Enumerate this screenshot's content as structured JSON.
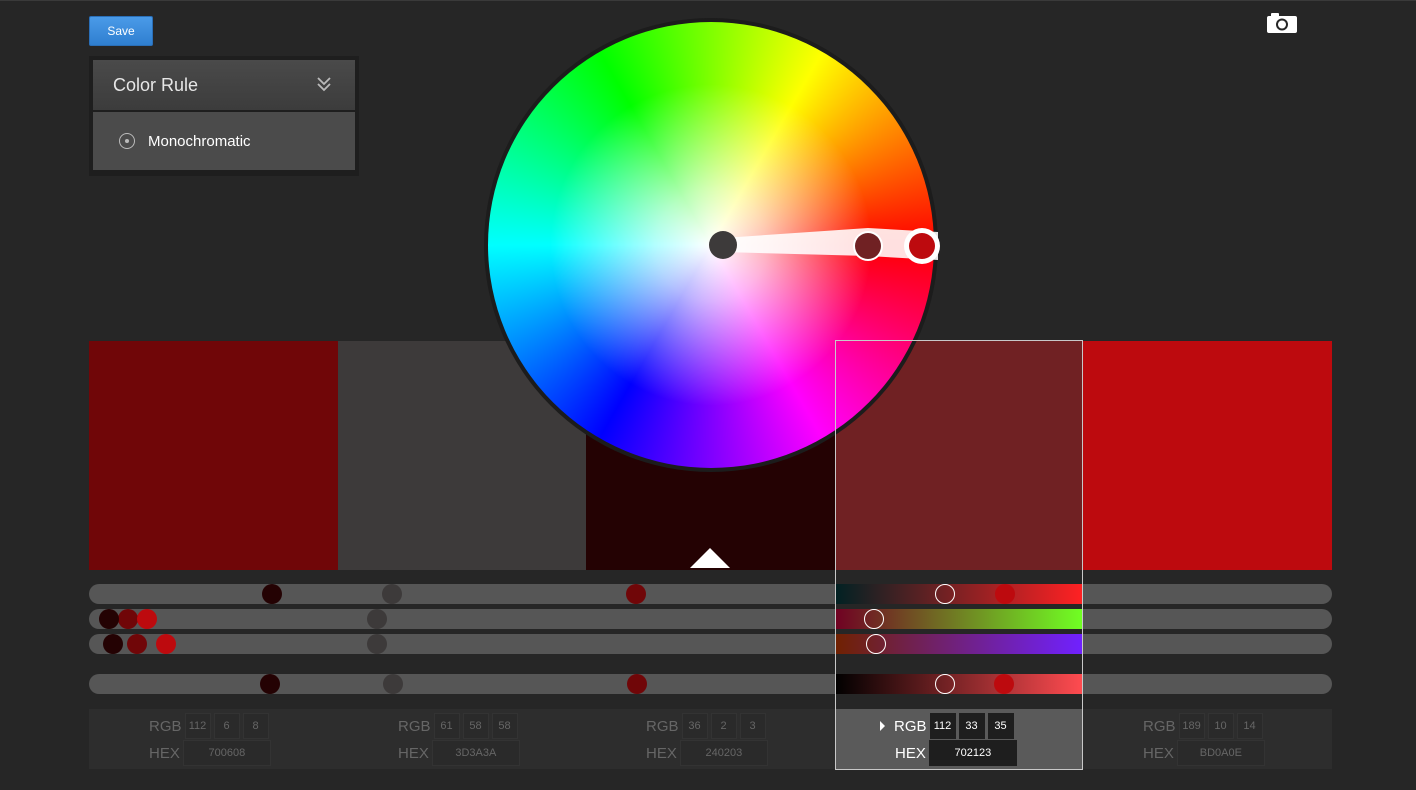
{
  "toolbar": {
    "save_label": "Save",
    "camera_icon": "camera-icon"
  },
  "color_rule": {
    "title": "Color Rule",
    "selected": "Monochromatic"
  },
  "swatches": [
    {
      "hex": "700608",
      "r": "112",
      "g": "6",
      "b": "8"
    },
    {
      "hex": "3D3A3A",
      "r": "61",
      "g": "58",
      "b": "58"
    },
    {
      "hex": "240203",
      "r": "36",
      "g": "2",
      "b": "3"
    },
    {
      "hex": "702123",
      "r": "112",
      "g": "33",
      "b": "35"
    },
    {
      "hex": "BD0A0E",
      "r": "189",
      "g": "10",
      "b": "14"
    }
  ],
  "selected_index": 3,
  "labels": {
    "rgb": "RGB",
    "hex": "HEX"
  },
  "sliders": {
    "red": [
      112,
      61,
      36,
      112,
      189
    ],
    "green": [
      6,
      58,
      2,
      33,
      10
    ],
    "blue": [
      8,
      58,
      3,
      35,
      14
    ],
    "brightness": [
      44,
      24,
      14,
      44,
      74
    ]
  },
  "colors": {
    "accent": "#2f7fd0",
    "background": "#262626"
  }
}
